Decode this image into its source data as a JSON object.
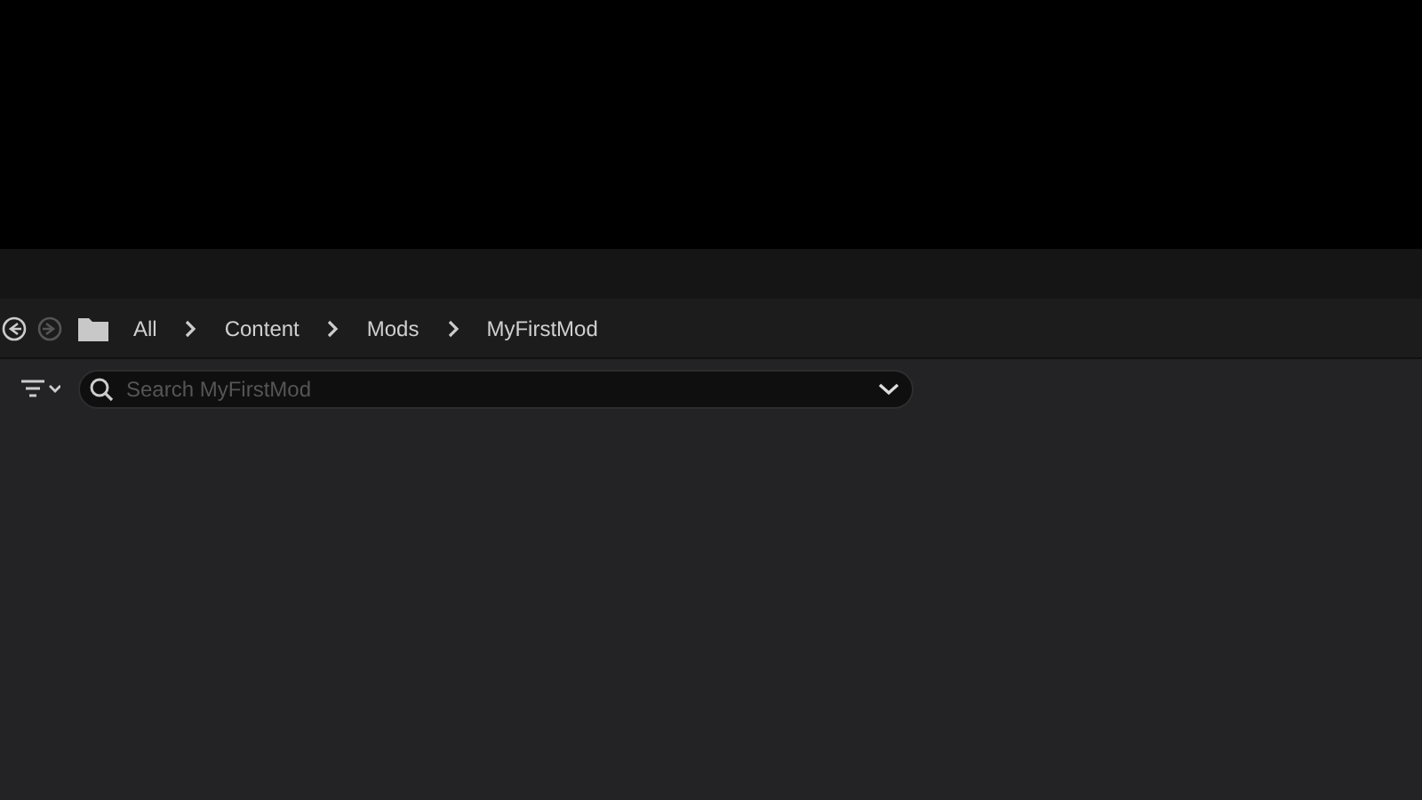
{
  "navigation": {
    "back": {
      "disabled": false
    },
    "forward": {
      "disabled": true
    }
  },
  "breadcrumbs": [
    {
      "label": "All"
    },
    {
      "label": "Content"
    },
    {
      "label": "Mods"
    },
    {
      "label": "MyFirstMod"
    }
  ],
  "search": {
    "placeholder": "Search MyFirstMod"
  }
}
